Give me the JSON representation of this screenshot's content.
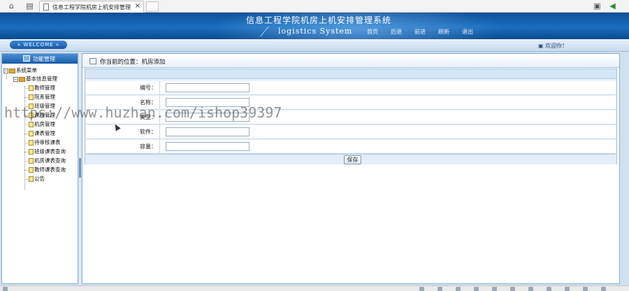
{
  "browser": {
    "tab_title": "信息工程学院机房上机安排管理",
    "tab_close": "×"
  },
  "header": {
    "title": "信息工程学院机房上机安排管理系统",
    "subtitle": "logistics System",
    "nav": [
      "首页",
      "后退",
      "前进",
      "刷新",
      "退出"
    ]
  },
  "welcome": {
    "pill": "WELCOME",
    "user_text": "欢迎你！"
  },
  "sidebar": {
    "header": "功能管理",
    "root": "系统菜单",
    "group": "基本信息管理",
    "items": [
      "教师管理",
      "院系管理",
      "班级管理",
      "课程管理",
      "机房管理",
      "课表管理",
      "待审核课表",
      "班级课表查询",
      "机房课表查询",
      "教师课表查询",
      "公告"
    ]
  },
  "main": {
    "breadcrumb": "你当前的位置：机房添加",
    "form": {
      "fields": [
        {
          "label": "编号：",
          "value": ""
        },
        {
          "label": "名称：",
          "value": ""
        },
        {
          "label": "类型：",
          "value": ""
        },
        {
          "label": "软件：",
          "value": ""
        },
        {
          "label": "容量：",
          "value": ""
        }
      ],
      "save_label": "保存"
    }
  },
  "watermark": "https://www.huzhan.com/ishop39397",
  "colors": {
    "header_blue": "#1a6fc0",
    "panel_border": "#8db0d4",
    "accent": "#1759a8"
  }
}
